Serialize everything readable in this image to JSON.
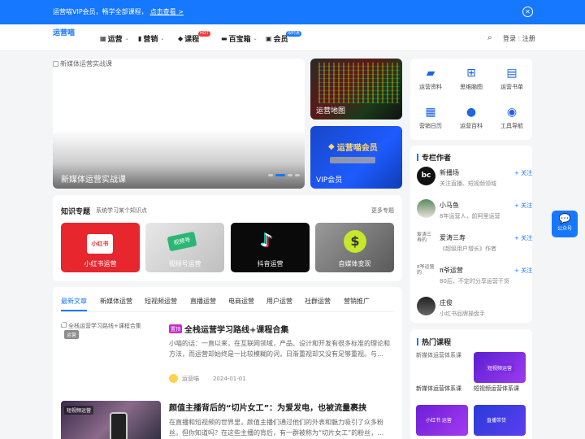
{
  "banner": {
    "text": "运营喵VIP会员，畅学全部课程，",
    "link": "点击查看 >",
    "close_icon": "close-circle-icon"
  },
  "header": {
    "logo_alt": "运营喵",
    "nav": [
      {
        "label": "运营",
        "icon": "calendar-icon",
        "caret": "⌄"
      },
      {
        "label": "营销",
        "icon": "bar-chart-icon",
        "caret": "⌄"
      },
      {
        "label": "课程",
        "icon": "graduation-cap-icon",
        "badge": "HOT"
      },
      {
        "label": "百宝箱",
        "icon": "toolbox-icon",
        "caret": "⌄"
      },
      {
        "label": "会员",
        "icon": "vip-icon",
        "badge": "限时惠"
      }
    ],
    "login": "登录",
    "separator": "|",
    "register": "注册"
  },
  "hero": {
    "alt": "新媒体运营实战课",
    "caption": "新媒体运营实战课"
  },
  "promo": [
    {
      "caption": "运营地图"
    },
    {
      "title": "运营喵会员",
      "caption": "VIP会员"
    }
  ],
  "tools": [
    {
      "label": "运营资料",
      "icon": "folder-icon"
    },
    {
      "label": "思维脑图",
      "icon": "mindmap-icon"
    },
    {
      "label": "运营书单",
      "icon": "book-icon"
    },
    {
      "label": "营销日历",
      "icon": "calendar-icon"
    },
    {
      "label": "运营百科",
      "icon": "question-icon"
    },
    {
      "label": "工具导航",
      "icon": "compass-icon"
    }
  ],
  "authors": {
    "title": "专栏作者",
    "follow": "+ 关注",
    "list": [
      {
        "name": "新播场",
        "desc": "关注直播、短视频领域",
        "avatar": "bc"
      },
      {
        "name": "小马鱼",
        "desc": "8年运营人，前阿里运营",
        "avatar": ""
      },
      {
        "name": "爱涛三寿",
        "desc": "《超级用户增长》作者",
        "avatar": "爱涛三寿的"
      },
      {
        "name": "π爷运营",
        "desc": "80后，不定时分享运营干货",
        "avatar": "π爷运营的"
      },
      {
        "name": "庄俊",
        "desc": "小红书品牌操盘手",
        "avatar": ""
      }
    ]
  },
  "courses": {
    "title": "热门课程",
    "list": [
      {
        "alt": "新媒体运营体系课",
        "caption": "新媒体运营体系课"
      },
      {
        "alt": "",
        "caption": "短视频运营体系课",
        "banner": "短视频运营"
      },
      {
        "alt": "",
        "caption": "",
        "banner": "小红书 运营"
      },
      {
        "alt": "",
        "caption": "",
        "banner": "直播带货"
      }
    ]
  },
  "knowledge": {
    "title": "知识专题",
    "subtitle": "系统学习某个知识点",
    "more": "更多专题",
    "items": [
      {
        "caption": "小红书运营",
        "art": "小红书"
      },
      {
        "caption": "视频号运营",
        "art": "视频号"
      },
      {
        "caption": "抖音运营"
      },
      {
        "caption": "自媒体变现",
        "art": "$"
      }
    ]
  },
  "articles": {
    "tabs": [
      "最新文章",
      "新媒体运营",
      "短视频运营",
      "直播运营",
      "电商运营",
      "用户运营",
      "社群运营",
      "营销推广"
    ],
    "list": [
      {
        "img_alt": "全栈运营学习路线+课程合集",
        "tag": "运营",
        "pin": "置顶",
        "title": "全栈运营学习路线+课程合集",
        "desc": "小喵的话：一直以来，在互联网领域，产品、设计和开发有很多标准的理论和方法，而运营却始终是一比较模糊的词，日渐重视却又没有足够重视。与…",
        "author": "运营喵",
        "date": "2024-01-01"
      },
      {
        "img_alt": "",
        "tag": "短视频运营",
        "title": "颜值主播背后的“切片女工”：为爱发电，也被流量裹挟",
        "desc": "在直播和短视频的世界里，颜值主播们通过他们的外表和魅力吸引了众多粉丝。但你知道吗？在这些主播的背后，有一群被称为“切片女工”的粉丝，…"
      }
    ]
  },
  "float": {
    "label": "公众号",
    "icon": "wechat-icon"
  },
  "search_icon": "search-icon"
}
